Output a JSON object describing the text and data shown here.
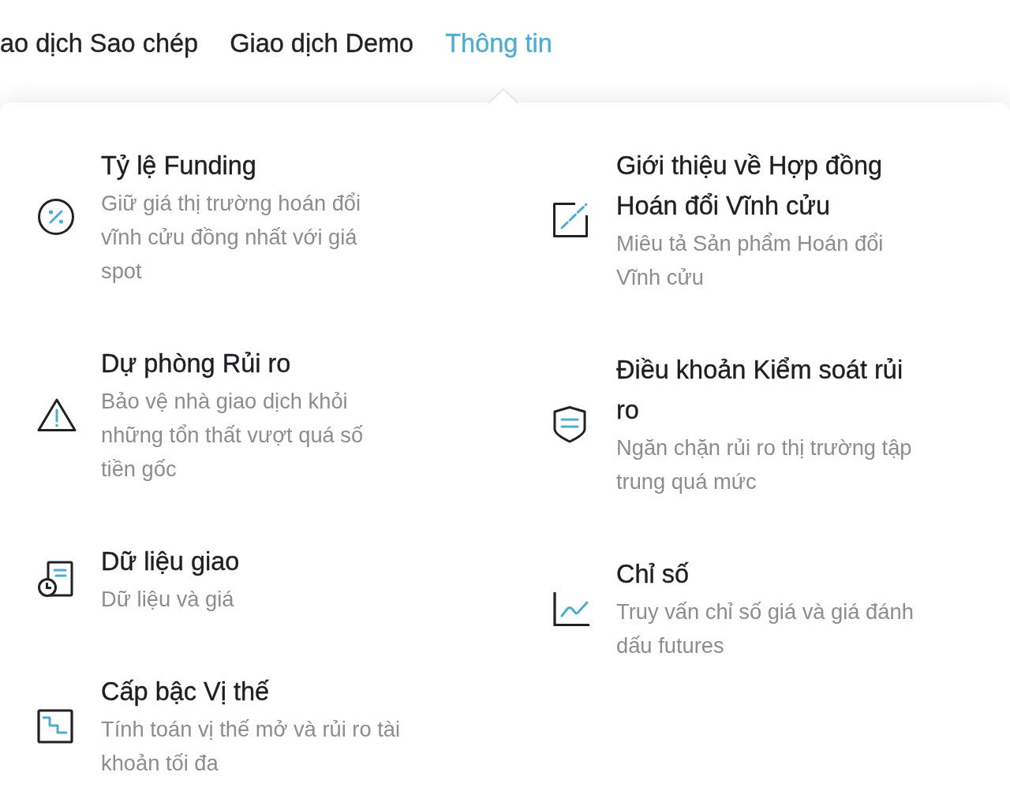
{
  "nav": {
    "tabs": [
      {
        "label": "ao dịch Sao chép",
        "selected": false
      },
      {
        "label": "Giao dịch Demo",
        "selected": false
      },
      {
        "label": "Thông tin",
        "selected": true
      }
    ]
  },
  "menu": {
    "columns": [
      {
        "items": [
          {
            "title": "Tỷ lệ Funding",
            "description": "Giữ giá thị trường hoán đổi vĩnh cửu đồng nhất với giá spot"
          },
          {
            "title": "Dự phòng Rủi ro",
            "description": "Bảo vệ nhà giao dịch khỏi những tổn thất vượt quá số tiền gốc"
          },
          {
            "title": "Dữ liệu giao",
            "description": "Dữ liệu và giá"
          },
          {
            "title": "Cấp bậc Vị thế",
            "description": "Tính toán vị thế mở và rủi ro tài khoản tối đa"
          }
        ]
      },
      {
        "items": [
          {
            "title": "Giới thiệu về Hợp đồng Hoán đổi Vĩnh cửu",
            "description": "Miêu tả Sản phẩm Hoán đổi Vĩnh cửu"
          },
          {
            "title": "Điều khoản Kiểm soát rủi ro",
            "description": "Ngăn chặn rủi ro thị trường tập trung quá mức"
          },
          {
            "title": "Chỉ số",
            "description": "Truy vấn chỉ số giá và giá đánh dấu futures"
          }
        ]
      }
    ]
  }
}
